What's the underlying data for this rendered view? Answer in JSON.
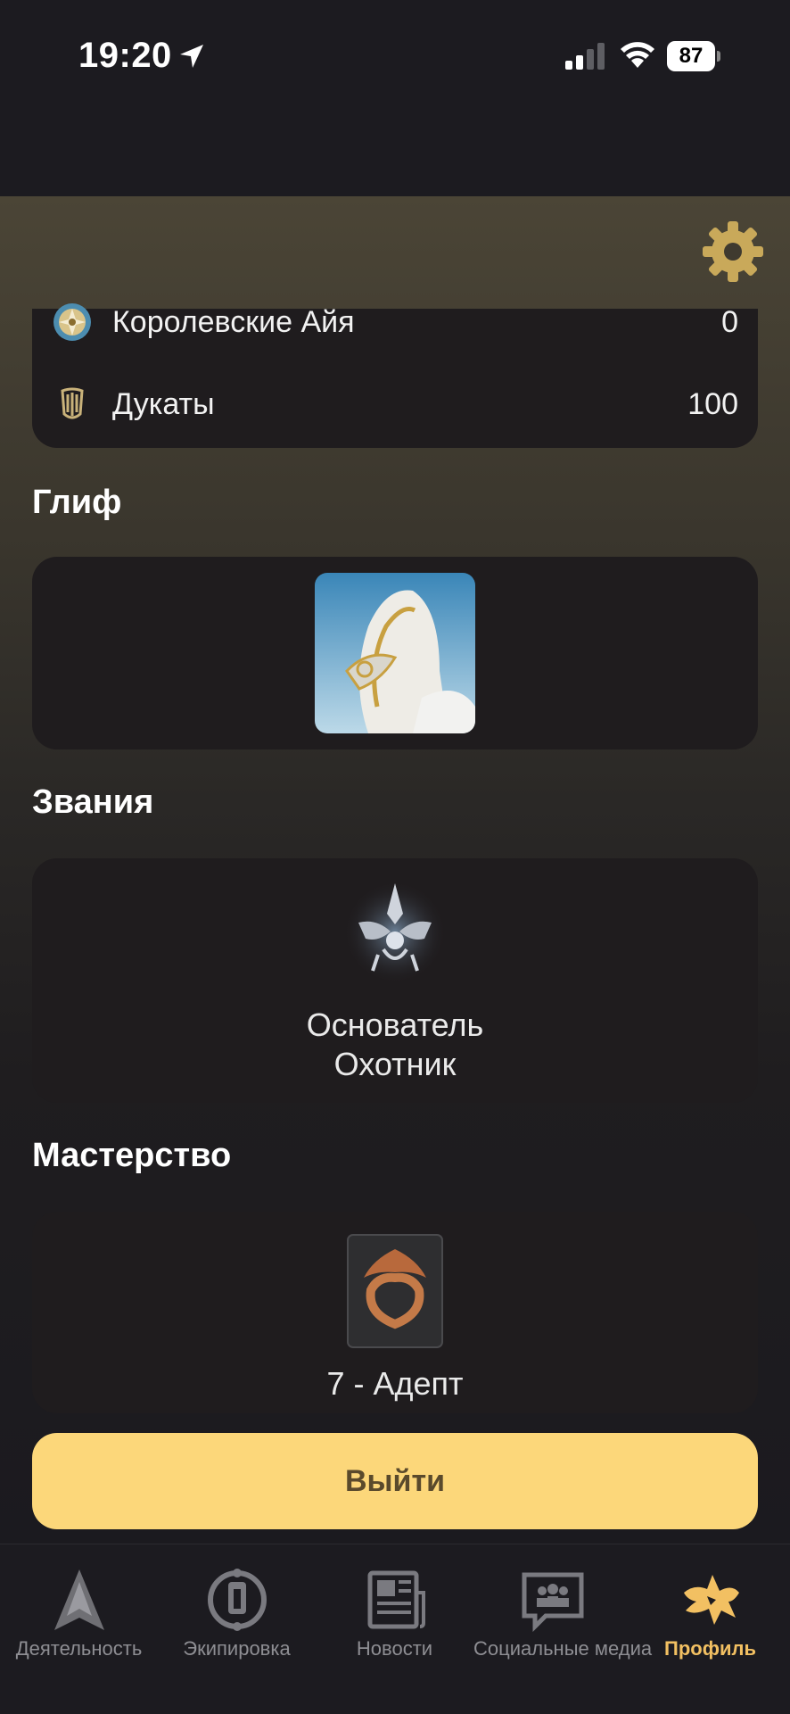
{
  "status_bar": {
    "time": "19:20",
    "battery": "87"
  },
  "currencies": [
    {
      "label": "Королевские Айя",
      "value": "0",
      "icon": "royal-aya-icon"
    },
    {
      "label": "Дукаты",
      "value": "100",
      "icon": "ducats-icon"
    }
  ],
  "glyph": {
    "title": "Глиф"
  },
  "ranks": {
    "title": "Звания",
    "line1": "Основатель",
    "line2": "Охотник"
  },
  "mastery": {
    "title": "Мастерство",
    "text": "7 - Адепт"
  },
  "logout_label": "Выйти",
  "tabs": [
    {
      "label": "Деятельность",
      "icon": "activity-icon"
    },
    {
      "label": "Экипировка",
      "icon": "arsenal-icon"
    },
    {
      "label": "Новости",
      "icon": "news-icon"
    },
    {
      "label": "Социальные медиа",
      "icon": "social-icon"
    },
    {
      "label": "Профиль",
      "icon": "profile-icon",
      "active": true
    }
  ],
  "colors": {
    "accent": "#fcd77a",
    "active_tab": "#f2c062",
    "card": "#1f1c1e",
    "background": "#1b1a1f"
  }
}
